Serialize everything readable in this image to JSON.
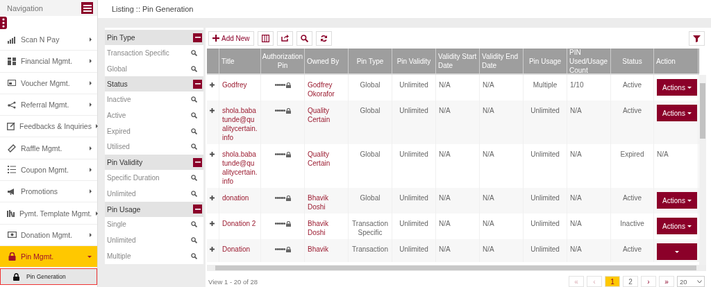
{
  "sidebar": {
    "title": "Navigation",
    "items": [
      {
        "label": "Scan N Pay",
        "kind": "chart",
        "expanded": false,
        "selected": false
      },
      {
        "label": "Financial Mgmt.",
        "kind": "grid",
        "expanded": false,
        "selected": false
      },
      {
        "label": "Voucher Mgmt.",
        "kind": "card",
        "expanded": false,
        "selected": false
      },
      {
        "label": "Referral Mgmt.",
        "kind": "share",
        "expanded": false,
        "selected": false
      },
      {
        "label": "Feedbacks & Inquiries",
        "kind": "edit",
        "expanded": false,
        "selected": false
      },
      {
        "label": "Raffle Mgmt.",
        "kind": "ticket",
        "expanded": false,
        "selected": false
      },
      {
        "label": "Coupon Mgmt.",
        "kind": "list",
        "expanded": false,
        "selected": false
      },
      {
        "label": "Promotions",
        "kind": "megaphone",
        "expanded": false,
        "selected": false
      },
      {
        "label": "Pymt. Template Mgmt.",
        "kind": "books",
        "expanded": false,
        "selected": false
      },
      {
        "label": "Donation Mgmt.",
        "kind": "money",
        "expanded": false,
        "selected": false
      },
      {
        "label": "Pin Mgmt.",
        "kind": "lock",
        "expanded": true,
        "selected": true,
        "children": [
          {
            "label": "Pin Generation",
            "selected": true
          }
        ]
      }
    ]
  },
  "breadcrumb": "Listing :: Pin Generation",
  "filters": [
    {
      "title": "Pin Type",
      "expanded": true,
      "items": [
        "Transaction Specific",
        "Global"
      ]
    },
    {
      "title": "Status",
      "expanded": true,
      "items": [
        "Inactive",
        "Active",
        "Expired",
        "Utilised"
      ]
    },
    {
      "title": "Pin Validity",
      "expanded": true,
      "items": [
        "Specific Duration",
        "Unlimited"
      ]
    },
    {
      "title": "Pin Usage",
      "expanded": true,
      "items": [
        "Single",
        "Unlimited",
        "Multiple"
      ]
    }
  ],
  "toolbar": {
    "add_label": "Add New"
  },
  "table": {
    "columns": [
      "Title",
      "Authorization Pin",
      "Owned By",
      "Pin Type",
      "Pin Validity",
      "Validity Start Date",
      "Validity End Date",
      "Pin Usage",
      "PIN Used/Usage Count",
      "Status",
      "Action"
    ],
    "rows": [
      {
        "title": "Godfrey",
        "pin": "••••••",
        "owner": "Godfrey Okorafor",
        "pin_type": "Global",
        "validity": "Unlimited",
        "start": "N/A",
        "end": "N/A",
        "usage": "Multiple",
        "count": "1/10",
        "status": "Active",
        "action": {
          "kind": "button",
          "label": "Actions"
        }
      },
      {
        "title": "shola.babatunde@qualitycertain.info",
        "pin": "••••••",
        "owner": "Quality Certain",
        "pin_type": "Global",
        "validity": "Unlimited",
        "start": "N/A",
        "end": "N/A",
        "usage": "Unlimited",
        "count": "N/A",
        "status": "Active",
        "action": {
          "kind": "button",
          "label": "Actions"
        }
      },
      {
        "title": "shola.babatunde@qualitycertain.info",
        "pin": "••••••",
        "owner": "Quality Certain",
        "pin_type": "Global",
        "validity": "Unlimited",
        "start": "N/A",
        "end": "N/A",
        "usage": "Unlimited",
        "count": "N/A",
        "status": "Expired",
        "action": {
          "kind": "text",
          "label": "N/A"
        }
      },
      {
        "title": "donation",
        "pin": "••••••",
        "owner": "Bhavik Doshi",
        "pin_type": "Global",
        "validity": "Unlimited",
        "start": "N/A",
        "end": "N/A",
        "usage": "Unlimited",
        "count": "N/A",
        "status": "Active",
        "action": {
          "kind": "button",
          "label": "Actions"
        }
      },
      {
        "title": "Donation 2",
        "pin": "••••••",
        "owner": "Bhavik Doshi",
        "pin_type": "Transaction Specific",
        "validity": "Unlimited",
        "start": "N/A",
        "end": "N/A",
        "usage": "Unlimited",
        "count": "N/A",
        "status": "Inactive",
        "action": {
          "kind": "button",
          "label": "Actions"
        }
      },
      {
        "title": "Donation",
        "pin": "••••••",
        "owner": "Bhavik",
        "pin_type": "Transaction",
        "validity": "Unlimited",
        "start": "N/A",
        "end": "N/A",
        "usage": "Unlimited",
        "count": "N/A",
        "status": "Active",
        "action": {
          "kind": "button"
        }
      }
    ]
  },
  "footer": {
    "view": "View 1 - 20 of 28",
    "first": "«",
    "prev": "‹",
    "pages": [
      {
        "label": "1",
        "selected": true
      },
      {
        "label": "2",
        "selected": false
      }
    ],
    "next": "›",
    "last": "»",
    "page_size": "20"
  }
}
